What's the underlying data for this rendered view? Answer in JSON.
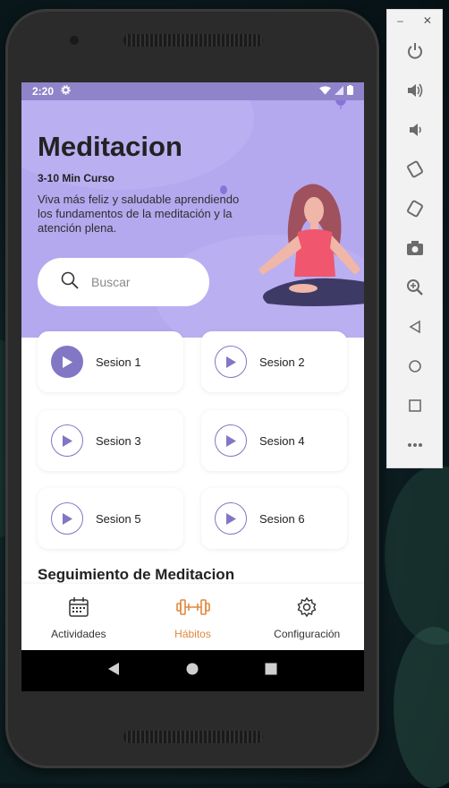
{
  "status": {
    "time": "2:20"
  },
  "hero": {
    "title": "Meditacion",
    "subtitle": "3-10 Min Curso",
    "description": "Viva más feliz y saludable aprendiendo los fundamentos de la meditación y la atención plena."
  },
  "search": {
    "placeholder": "Buscar"
  },
  "sessions": [
    {
      "label": "Sesion 1",
      "active": true
    },
    {
      "label": "Sesion 2",
      "active": false
    },
    {
      "label": "Sesion 3",
      "active": false
    },
    {
      "label": "Sesion 4",
      "active": false
    },
    {
      "label": "Sesion 5",
      "active": false
    },
    {
      "label": "Sesion 6",
      "active": false
    }
  ],
  "section": {
    "title": "Seguimiento de Meditacion"
  },
  "bottom_nav": {
    "items": [
      {
        "label": "Actividades",
        "icon": "calendar-icon"
      },
      {
        "label": "Hábitos",
        "icon": "dumbbell-icon",
        "active": true
      },
      {
        "label": "Configuración",
        "icon": "gear-icon"
      }
    ]
  },
  "colors": {
    "hero_bg": "#b4a9ef",
    "accent_purple": "#8277c4",
    "active_orange": "#e0883e",
    "status_bar": "#8f84c9"
  },
  "emulator_panel": {
    "window_controls": [
      "minimize-icon",
      "close-icon"
    ],
    "buttons": [
      "power-icon",
      "volume-up-icon",
      "volume-down-icon",
      "rotate-left-icon",
      "rotate-right-icon",
      "camera-icon",
      "zoom-icon",
      "back-icon",
      "home-icon",
      "overview-icon",
      "more-icon"
    ]
  }
}
